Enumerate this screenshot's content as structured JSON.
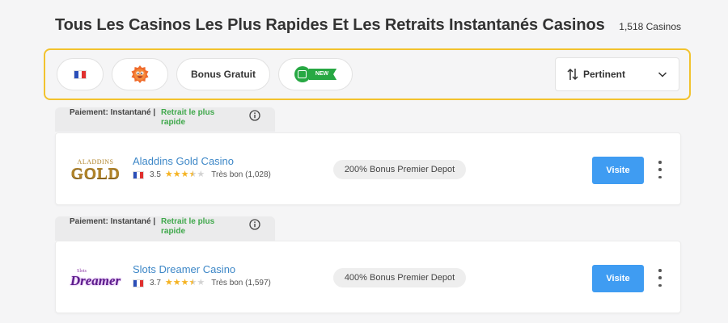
{
  "header": {
    "title": "Tous Les Casinos Les Plus Rapides Et Les Retraits Instantanés Casinos",
    "count": "1,518 Casinos"
  },
  "filters": {
    "bonus_label": "Bonus Gratuit",
    "new_label": "NEW",
    "sort_label": "Pertinent",
    "flag_icon": "france-flag-icon",
    "mascot_icon": "orange-mascot-icon"
  },
  "tabs": {
    "payment_label": "Paiement: Instantané |",
    "fast_label": "Retrait le plus rapide"
  },
  "casinos": [
    {
      "name": "Aladdins Gold Casino",
      "logo_top": "ALADDINS",
      "logo_main": "GOLD",
      "rating": "3.5",
      "rating_value": 3.5,
      "rating_text": "Très bon (1,028)",
      "bonus": "200% Bonus Premier Depot",
      "visit_label": "Visite"
    },
    {
      "name": "Slots Dreamer Casino",
      "logo_top": "Slots",
      "logo_main": "Dreamer",
      "rating": "3.7",
      "rating_value": 3.7,
      "rating_text": "Très bon (1,597)",
      "bonus": "400% Bonus Premier Depot",
      "visit_label": "Visite"
    }
  ],
  "colors": {
    "accent_yellow": "#f2c22d",
    "link_blue": "#3d87c7",
    "visit_blue": "#3f9cf2",
    "fast_green": "#3fa84b",
    "star": "#f5b323"
  }
}
